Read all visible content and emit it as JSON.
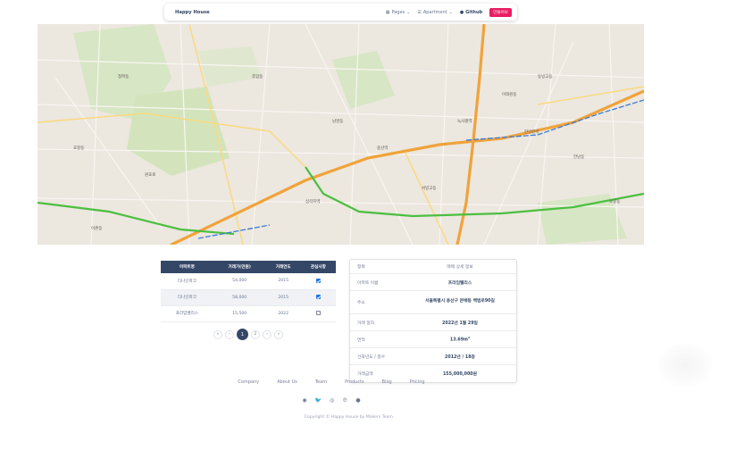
{
  "navbar": {
    "brand": "Happy House",
    "pages_label": "Pages",
    "apartment_label": "Apartment",
    "github_label": "Github",
    "login_label": "만들어보",
    "icons": {
      "pages": "grid-icon",
      "apartment": "list-icon",
      "github": "github-icon"
    }
  },
  "map": {
    "labels": [
      "용산역",
      "이태원동",
      "한남동",
      "후암동",
      "남영동",
      "원효로",
      "보광동",
      "서빙고동",
      "동빙고동",
      "한강진역",
      "삼각지역",
      "녹사평역",
      "이촌동",
      "청파동",
      "효창동"
    ]
  },
  "table": {
    "headers": [
      "아파트명",
      "거래가(만원)",
      "거래연도",
      "관심사항"
    ],
    "rows": [
      {
        "name": "다나인파크",
        "price": "54,000",
        "year": "2015",
        "checked": true
      },
      {
        "name": "다나인파크",
        "price": "58,000",
        "year": "2015",
        "checked": true
      },
      {
        "name": "프라임벨리스",
        "price": "15,500",
        "year": "2022",
        "checked": false
      }
    ]
  },
  "pagination": {
    "first": "«",
    "prev": "‹",
    "pages": [
      "1",
      "2"
    ],
    "active": "1",
    "next": "›",
    "last": "»"
  },
  "detail": {
    "header_label": "항목",
    "header_value": "매매 상세 정보",
    "rows": [
      {
        "label": "아파트 이름",
        "value": "프라임벨리스"
      },
      {
        "label": "주소",
        "value": "서울특별시 용산구 문배동 백범로90길"
      },
      {
        "label": "거래 일자",
        "value": "2022년 1월 29일"
      },
      {
        "label": "면적",
        "value": "13.69m",
        "sup": "2"
      },
      {
        "label": "건축년도 / 층수",
        "value": "2012년 / 18층"
      },
      {
        "label": "거래금액",
        "value": "155,000,000원"
      }
    ]
  },
  "footer": {
    "links": [
      "Company",
      "About Us",
      "Team",
      "Products",
      "Blog",
      "Pricing"
    ],
    "social": [
      {
        "name": "dribbble-icon",
        "glyph": "◉"
      },
      {
        "name": "twitter-icon",
        "glyph": "🐦"
      },
      {
        "name": "instagram-icon",
        "glyph": "◎"
      },
      {
        "name": "pinterest-icon",
        "glyph": "℗"
      },
      {
        "name": "github-icon",
        "glyph": "●"
      }
    ],
    "copyright": "Copyright © Happy House by Makers Team."
  },
  "colors": {
    "primary": "#344767",
    "accent": "#e91e63",
    "checkbox": "#1A73E8",
    "road_orange": "#f0a33a",
    "road_green": "#4bbf3f",
    "park": "#cfe3b6"
  }
}
